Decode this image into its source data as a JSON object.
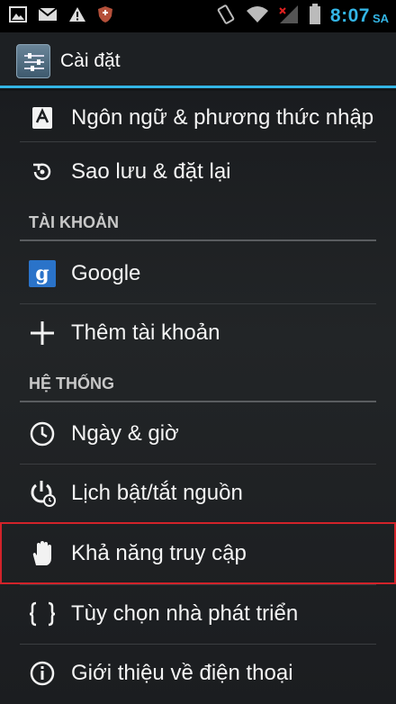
{
  "status_bar": {
    "icons_left": [
      "image-icon",
      "gmail-icon",
      "warning-icon",
      "shield-icon"
    ],
    "icons_right": [
      "vibrate-icon",
      "wifi-icon",
      "signal-icon",
      "battery-icon"
    ],
    "time": "8:07",
    "ampm": "SA"
  },
  "action_bar": {
    "title": "Cài đặt"
  },
  "list": {
    "items": [
      {
        "label": "Ngôn ngữ & phương thức nhập",
        "icon": "keyboard-a-icon"
      },
      {
        "label": "Sao lưu & đặt lại",
        "icon": "backup-restore-icon"
      },
      {
        "label": "Google",
        "icon": "google-icon"
      },
      {
        "label": "Thêm tài khoản",
        "icon": "plus-icon"
      },
      {
        "label": "Ngày & giờ",
        "icon": "clock-icon"
      },
      {
        "label": "Lịch bật/tắt nguồn",
        "icon": "power-schedule-icon"
      },
      {
        "label": "Khả năng truy cập",
        "icon": "hand-icon"
      },
      {
        "label": "Tùy chọn nhà phát triển",
        "icon": "braces-icon"
      },
      {
        "label": "Giới thiệu về điện thoại",
        "icon": "info-icon"
      }
    ],
    "sections": {
      "accounts": "TÀI KHOẢN",
      "system": "HỆ THỐNG"
    }
  },
  "colors": {
    "accent": "#33b5e5",
    "highlight": "#d2232a"
  }
}
